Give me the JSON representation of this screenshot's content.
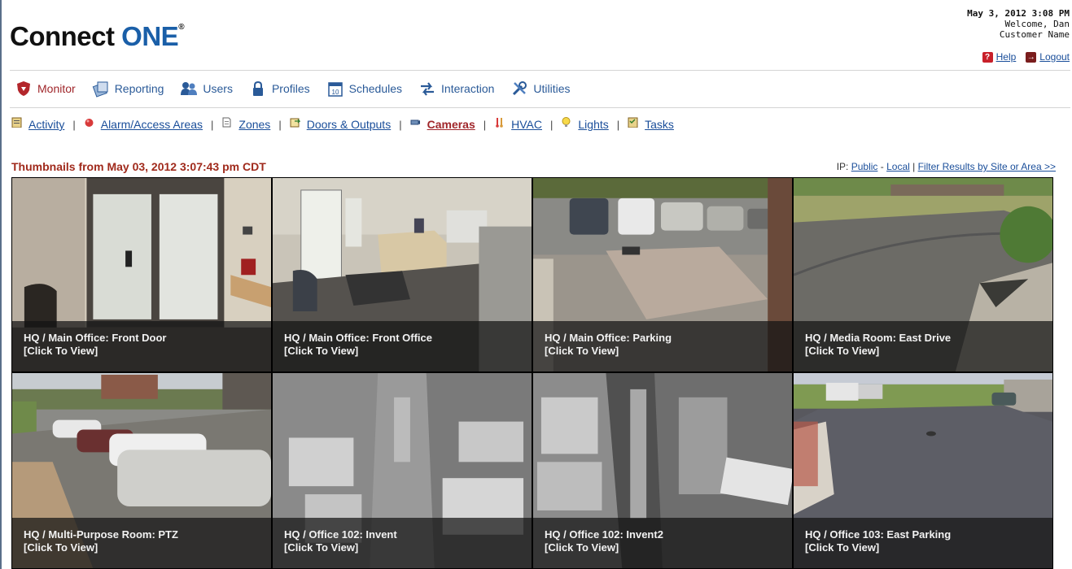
{
  "header": {
    "logo_main": "Connect",
    "logo_accent": "ONE",
    "logo_mark": "®",
    "date": "May 3, 2012 3:08 PM",
    "welcome": "Welcome, Dan",
    "customer": "Customer Name",
    "help_label": "Help",
    "logout_label": "Logout"
  },
  "mainnav": [
    {
      "label": "Monitor",
      "icon": "shield-icon",
      "active": true
    },
    {
      "label": "Reporting",
      "icon": "report-icon"
    },
    {
      "label": "Users",
      "icon": "users-icon"
    },
    {
      "label": "Profiles",
      "icon": "lock-icon"
    },
    {
      "label": "Schedules",
      "icon": "calendar-icon"
    },
    {
      "label": "Interaction",
      "icon": "arrows-icon"
    },
    {
      "label": "Utilities",
      "icon": "tools-icon"
    }
  ],
  "subnav": [
    {
      "label": "Activity",
      "icon": "clipboard-icon"
    },
    {
      "label": "Alarm/Access Areas",
      "icon": "alarm-icon"
    },
    {
      "label": "Zones",
      "icon": "page-icon"
    },
    {
      "label": "Doors & Outputs",
      "icon": "door-icon"
    },
    {
      "label": "Cameras",
      "icon": "camera-icon",
      "active": true
    },
    {
      "label": "HVAC",
      "icon": "thermometer-icon"
    },
    {
      "label": "Lights",
      "icon": "bulb-icon"
    },
    {
      "label": "Tasks",
      "icon": "tasks-icon"
    }
  ],
  "thumbnails": {
    "title": "Thumbnails from May 03, 2012 3:07:43 pm CDT",
    "ip_label": "IP:",
    "public_label": "Public",
    "dash": "-",
    "local_label": "Local",
    "pipe": "|",
    "filter_label": "Filter Results by Site or Area >>"
  },
  "cameras": [
    {
      "name": "HQ / Main Office: Front Door",
      "action": "[Click To View]"
    },
    {
      "name": "HQ / Main Office: Front Office",
      "action": "[Click To View]"
    },
    {
      "name": "HQ / Main Office: Parking",
      "action": "[Click To View]"
    },
    {
      "name": "HQ / Media Room: East Drive",
      "action": "[Click To View]"
    },
    {
      "name": "HQ / Multi-Purpose Room: PTZ",
      "action": "[Click To View]"
    },
    {
      "name": "HQ / Office 102: Invent",
      "action": "[Click To View]"
    },
    {
      "name": "HQ / Office 102: Invent2",
      "action": "[Click To View]"
    },
    {
      "name": "HQ / Office 103: East Parking",
      "action": "[Click To View]"
    }
  ],
  "colors": {
    "brand_blue": "#1a5fa8",
    "nav_blue": "#2a5a98",
    "active_red": "#a0262a",
    "title_red": "#a02a1c"
  }
}
